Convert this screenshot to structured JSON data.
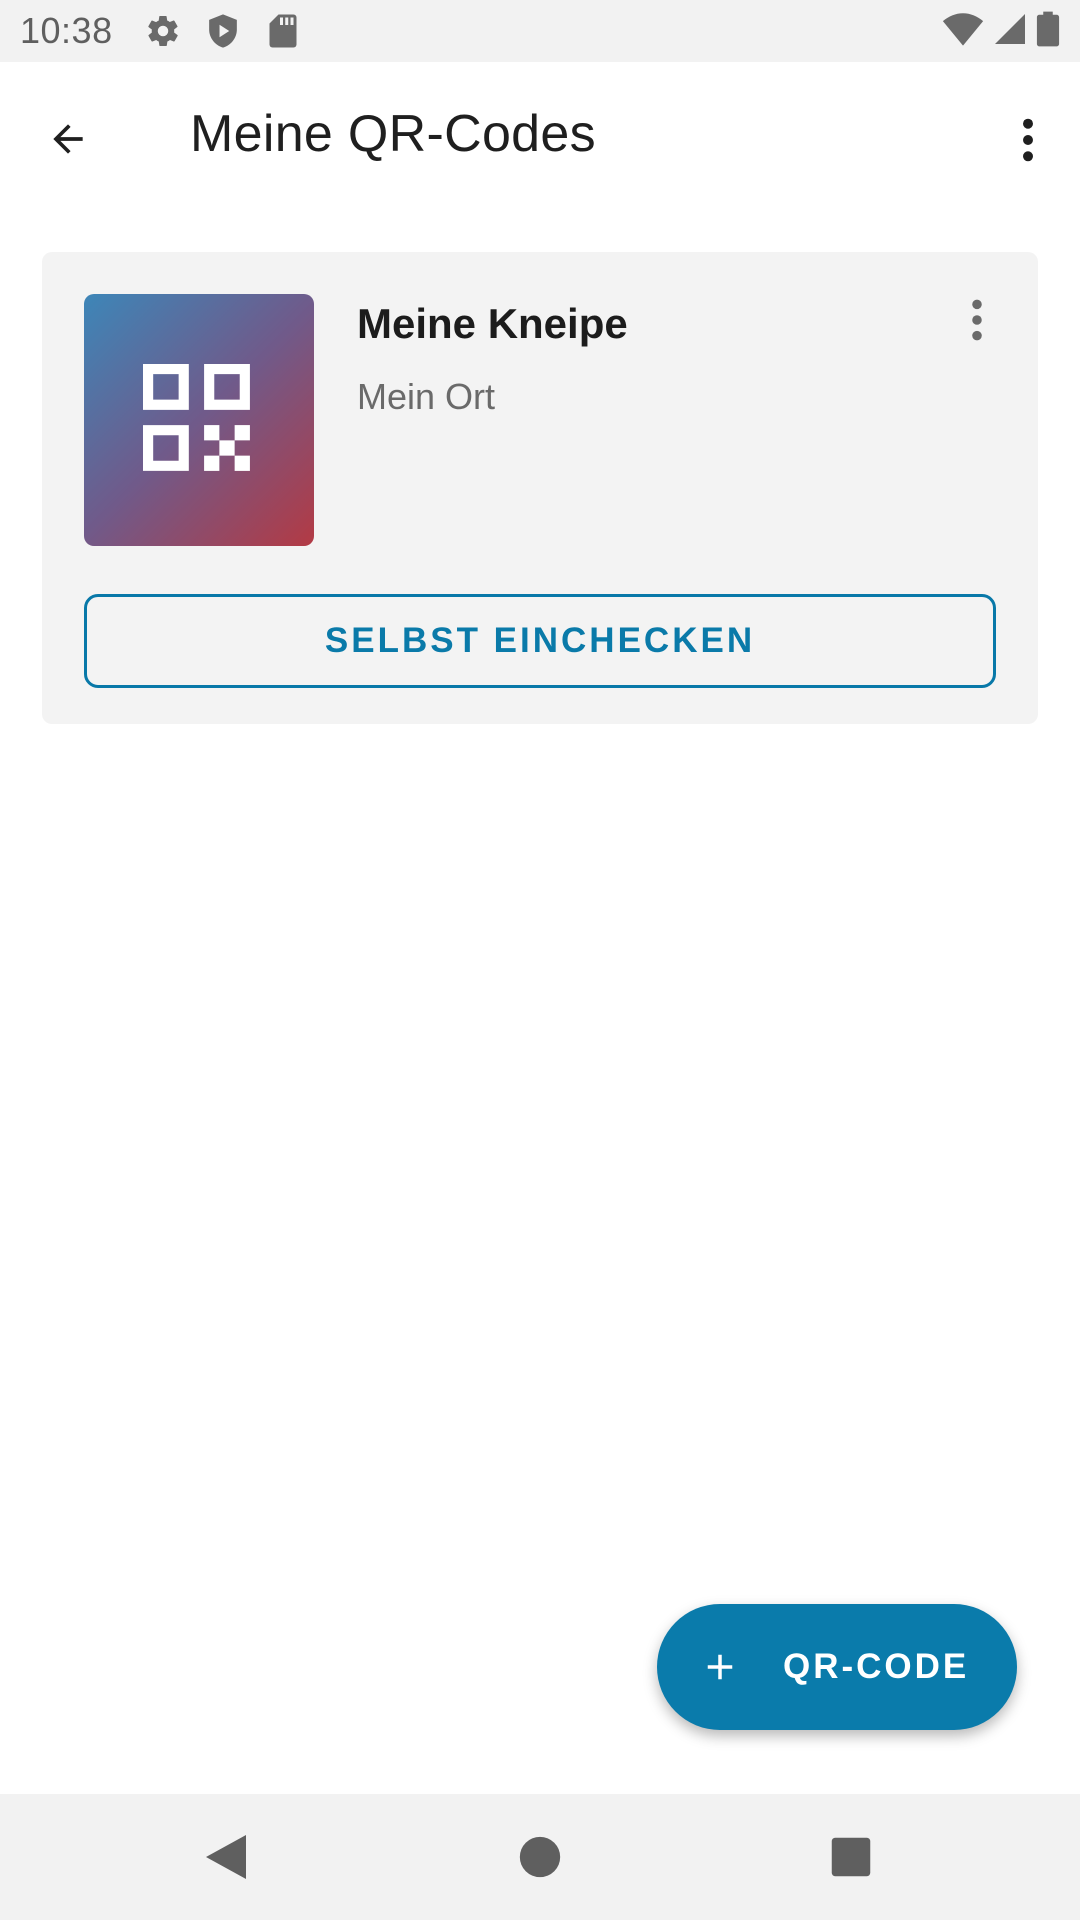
{
  "status_bar": {
    "time": "10:38",
    "icons": [
      "settings-icon",
      "shield-play-icon",
      "sd-card-icon",
      "wifi-icon",
      "signal-icon",
      "battery-icon"
    ]
  },
  "app_bar": {
    "title": "Meine QR-Codes",
    "back_icon": "arrow-back-icon",
    "menu_icon": "more-vert-icon"
  },
  "card": {
    "title": "Meine Kneipe",
    "subtitle": "Mein Ort",
    "image_icon": "qr-code-icon",
    "menu_icon": "more-vert-icon",
    "checkin_label": "SELBST EINCHECKEN"
  },
  "fab": {
    "label": "QR-CODE",
    "icon": "plus-icon"
  },
  "nav_bar": {
    "buttons": [
      "back-triangle-icon",
      "home-circle-icon",
      "recents-square-icon"
    ]
  },
  "colors": {
    "accent": "#0a7bab",
    "card_bg": "#f3f3f3",
    "statusbar_bg": "#f2f2f2"
  }
}
